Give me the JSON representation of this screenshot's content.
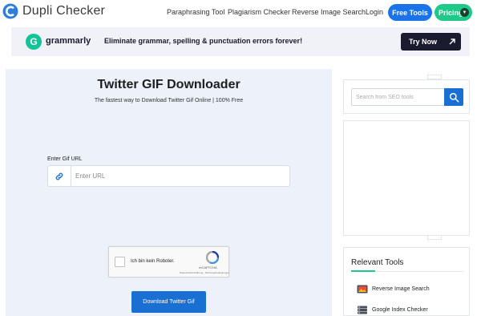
{
  "brand": {
    "name": "Dupli Checker",
    "accent": "#1a73e8",
    "green": "#1fc98a"
  },
  "nav": {
    "links": [
      "Paraphrasing Tool",
      "Plagiarism Checker",
      "Reverse Image Search",
      "Login"
    ],
    "free_tools": "Free Tools",
    "pricing": "Pricing"
  },
  "ad": {
    "brand": "grammarly",
    "tagline": "Eliminate grammar, spelling & punctuation errors forever!",
    "cta": "Try Now",
    "logo_letter": "G"
  },
  "main": {
    "title": "Twitter GIF Downloader",
    "subtitle": "The fastest way to Download Twitter Gif Online | 100% Free",
    "url_label": "Enter Gif URL",
    "url_placeholder": "Enter URL",
    "captcha_label": "Ich bin kein Roboter.",
    "captcha_brand": "reCAPTCHA",
    "captcha_terms": "Datenschutzerklärung - Nutzungsbedingungen",
    "download_button": "Download Twitter Gif"
  },
  "sidebar": {
    "search_placeholder": "Search from SEO tools",
    "relevant_title": "Relevant Tools",
    "tools": [
      {
        "label": "Reverse Image Search",
        "icon": "image-search-icon"
      },
      {
        "label": "Google Index Checker",
        "icon": "google-index-icon"
      }
    ]
  }
}
